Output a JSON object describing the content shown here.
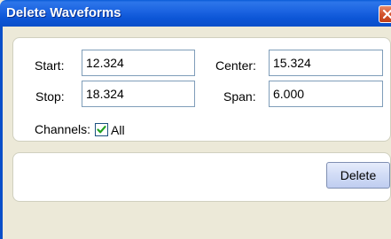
{
  "window": {
    "title": "Delete Waveforms"
  },
  "range": {
    "start_label": "Start:",
    "start_value": "12.324",
    "stop_label": "Stop:",
    "stop_value": "18.324",
    "center_label": "Center:",
    "center_value": "15.324",
    "span_label": "Span:",
    "span_value": "6.000"
  },
  "channels": {
    "label": "Channels:",
    "all_label": "All",
    "all_checked": true
  },
  "actions": {
    "delete_label": "Delete"
  },
  "colors": {
    "titlebar": "#0a4fc9",
    "dialog_background": "#ece9d8",
    "checkbox_check": "#21a121"
  },
  "icons": {
    "close": "close-icon",
    "check": "checkmark-icon"
  }
}
